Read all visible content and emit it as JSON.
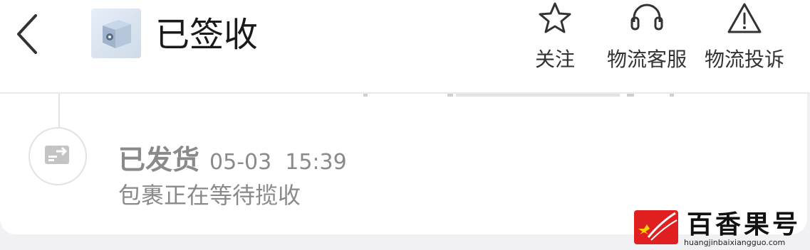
{
  "header": {
    "title": "已签收",
    "actions": [
      {
        "label": "关注",
        "icon": "star-icon"
      },
      {
        "label": "物流客服",
        "icon": "headset-icon"
      },
      {
        "label": "物流投诉",
        "icon": "warning-icon"
      }
    ]
  },
  "timeline": {
    "event": {
      "status": "已发货",
      "time": "05-03  15:39",
      "description": "包裹正在等待揽收",
      "icon": "shipped-truck-icon"
    }
  },
  "watermark": {
    "brand": "百香果号",
    "url": "huangjinbaixiangguo.com",
    "brand_color": "#e02020"
  },
  "colors": {
    "background": "#f1f1f3",
    "card": "#ffffff",
    "text_primary": "#1a1a1a",
    "text_muted": "#8a8a8a"
  }
}
